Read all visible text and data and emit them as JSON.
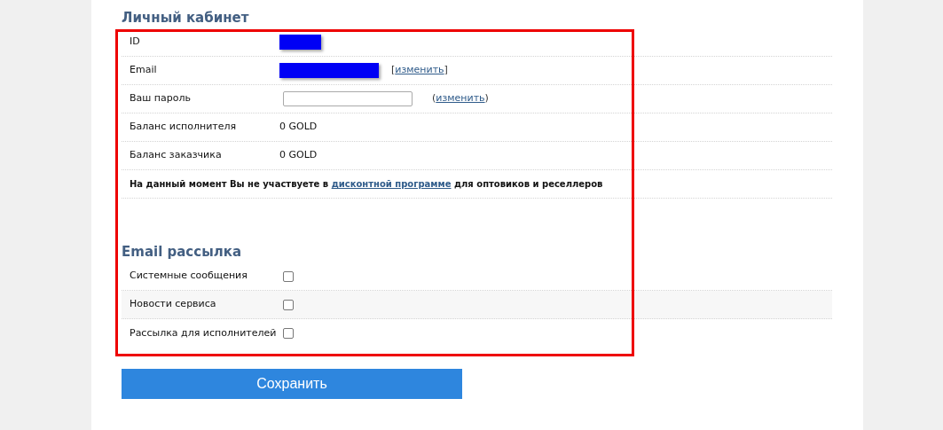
{
  "profile": {
    "title": "Личный кабинет",
    "rows": [
      {
        "kind": "redacted",
        "label": "ID",
        "wide": false
      },
      {
        "kind": "redacted",
        "label": "Email",
        "wide": true,
        "link_before": "[",
        "link": "изменить",
        "link_after": "]"
      },
      {
        "kind": "password",
        "label": "Ваш пароль",
        "link_before": "(",
        "link": "изменить",
        "link_after": ")"
      },
      {
        "kind": "text",
        "label": "Баланс исполнителя",
        "value": "0 GOLD"
      },
      {
        "kind": "text",
        "label": "Баланс заказчика",
        "value": "0 GOLD"
      },
      {
        "kind": "notice",
        "before": "На данный момент Вы не участвуете в ",
        "link": "дисконтной программе",
        "after": " для оптовиков и реселлеров"
      }
    ]
  },
  "mailing": {
    "title": "Email рассылка",
    "options": [
      {
        "label": "Системные сообщения",
        "checked": false
      },
      {
        "label": "Новости сервиса",
        "checked": false
      },
      {
        "label": "Рассылка для исполнителей",
        "checked": false
      }
    ]
  },
  "save_button": "Сохранить",
  "highlight": {
    "shown": true
  }
}
